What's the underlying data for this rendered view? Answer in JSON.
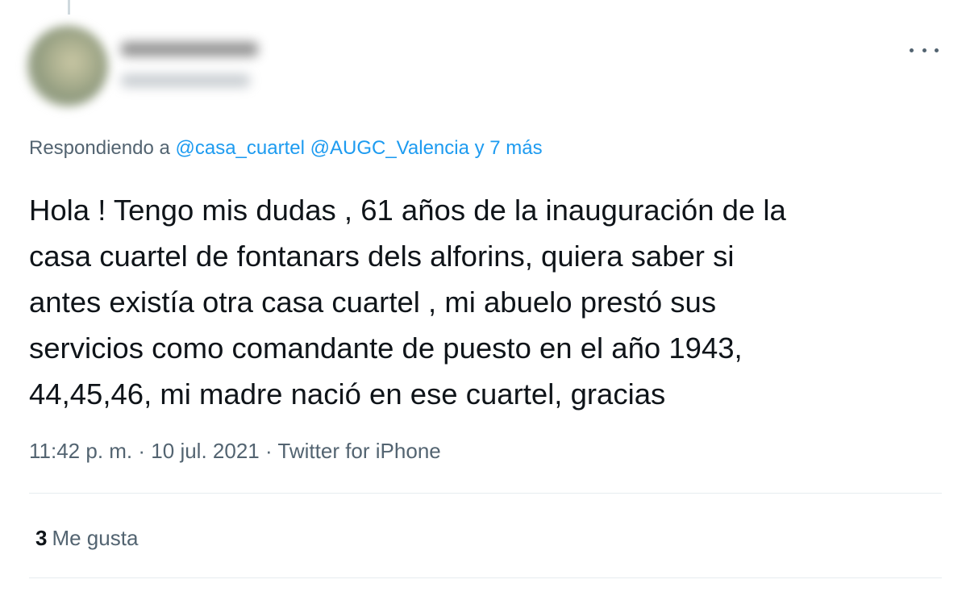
{
  "author": {
    "display_name_blurred": true,
    "handle_blurred": true
  },
  "icons": {
    "more": "more-horizontal-icon"
  },
  "reply": {
    "prefix": "Respondiendo a",
    "mentions": [
      "@casa_cuartel",
      "@AUGC_Valencia"
    ],
    "suffix": "y 7 más"
  },
  "tweet": {
    "text_lines": [
      "Hola ! Tengo mis dudas , 61 años de la inauguración de la",
      "casa cuartel de fontanars dels alforins, quiera saber si",
      "antes existía otra casa cuartel , mi abuelo prestó sus",
      "servicios como comandante de puesto en el año 1943,",
      "44,45,46, mi madre nació en ese cuartel, gracias"
    ]
  },
  "meta": {
    "time": "11:42 p. m.",
    "sep1": "·",
    "date": "10 jul. 2021",
    "sep2": "·",
    "source": "Twitter for iPhone"
  },
  "stats": {
    "likes_count": "3",
    "likes_label": "Me gusta"
  },
  "colors": {
    "link": "#1d9bf0",
    "secondary_text": "#536471",
    "primary_text": "#0f1419",
    "divider": "#e6ecf0"
  }
}
